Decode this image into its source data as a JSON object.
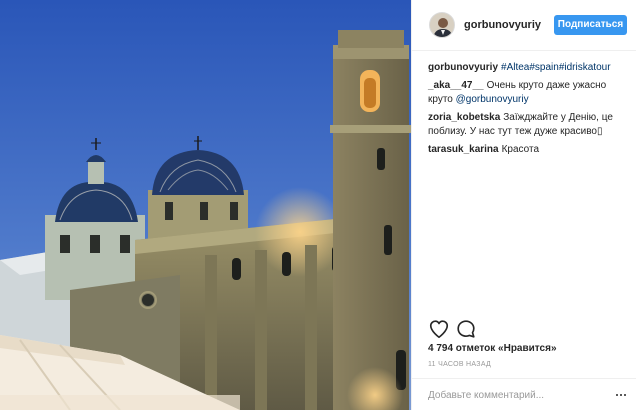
{
  "post": {
    "photo_alt": "Church of Altea at dusk"
  },
  "header": {
    "username": "gorbunovyuriy",
    "follow_label": "Подписаться"
  },
  "comments": [
    {
      "author": "gorbunovyuriy",
      "text": "#Altea#spain#idriskatour",
      "is_tags": true
    },
    {
      "author": "_aka__47__",
      "text": "Очень круто даже ужасно круто",
      "mention": "@gorbunovyuriy"
    },
    {
      "author": "zoria_kobetska",
      "text": "Заїжджайте у Денію, це поблизу. У нас тут теж дуже красиво▯"
    },
    {
      "author": "tarasuk_karina",
      "text": "Красота"
    }
  ],
  "actions": {
    "like_icon": "heart-icon",
    "comment_icon": "comment-icon"
  },
  "likes_text": "4 794 отметок «Нравится»",
  "timestamp": "11 часов назад",
  "add_comment": {
    "placeholder": "Добавьте комментарий...",
    "more_icon": "more-options-icon"
  },
  "colors": {
    "follow_button": "#3897f0",
    "link": "#003569",
    "sky_top": "#2a56b8",
    "sky_bottom": "#6f93d2"
  }
}
